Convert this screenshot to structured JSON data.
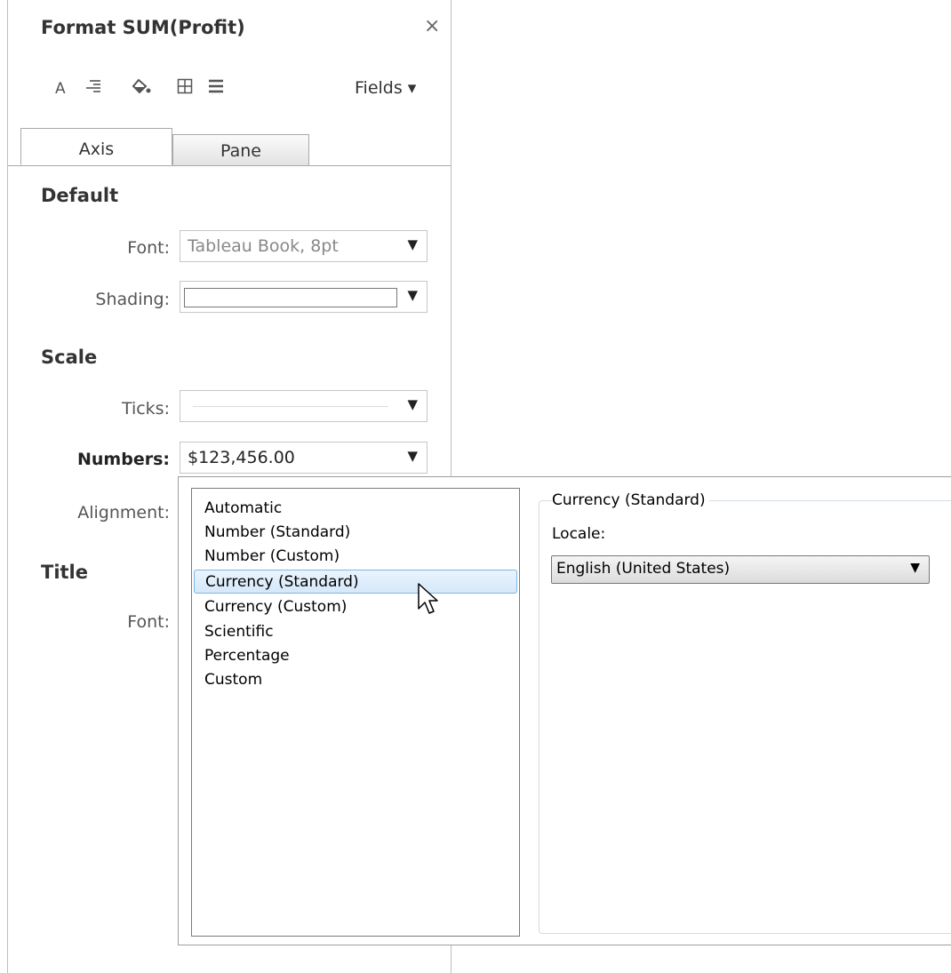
{
  "panel": {
    "title": "Format SUM(Profit)",
    "close_icon": "×",
    "toolbar": {
      "icons": [
        "font-icon",
        "alignment-icon",
        "shading-icon",
        "borders-icon",
        "lines-icon"
      ],
      "fields_label": "Fields ▾"
    },
    "tabs": [
      {
        "label": "Axis",
        "selected": true
      },
      {
        "label": "Pane",
        "selected": false
      }
    ],
    "default": {
      "heading": "Default",
      "font_label": "Font:",
      "font_value": "Tableau Book, 8pt",
      "shading_label": "Shading:"
    },
    "scale": {
      "heading": "Scale",
      "ticks_label": "Ticks:",
      "numbers_label": "Numbers:",
      "numbers_value": "$123,456.00",
      "alignment_label": "Alignment:"
    },
    "title_section": {
      "heading": "Title",
      "font_label": "Font:"
    }
  },
  "popup": {
    "formats": [
      "Automatic",
      "Number (Standard)",
      "Number (Custom)",
      "Currency (Standard)",
      "Currency (Custom)",
      "Scientific",
      "Percentage",
      "Custom"
    ],
    "selected_format": "Currency (Standard)",
    "group_title": "Currency (Standard)",
    "locale_label": "Locale:",
    "locale_value": "English (United States)"
  },
  "colors": {
    "selection_bg": "#d5e8fa",
    "selection_border": "#7fb4e6",
    "border": "#a9a9a9"
  }
}
